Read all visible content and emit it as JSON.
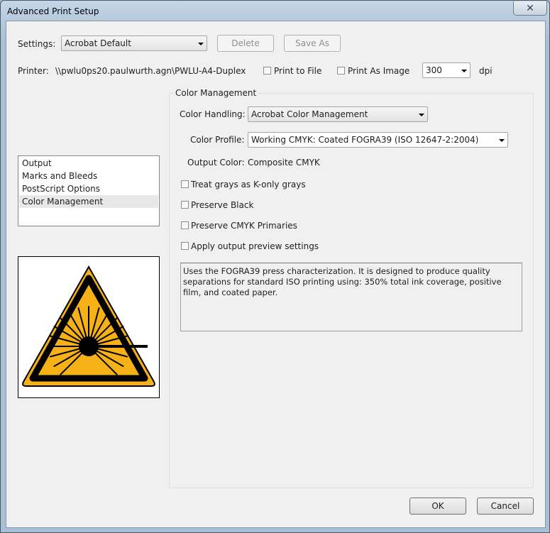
{
  "window": {
    "title": "Advanced Print Setup",
    "close_glyph": "✕"
  },
  "settings": {
    "label": "Settings:",
    "value": "Acrobat Default",
    "delete_label": "Delete",
    "save_as_label": "Save As"
  },
  "printer": {
    "label": "Printer:",
    "name": "\\\\pwlu0ps20.paulwurth.agn\\PWLU-A4-Duplex",
    "print_to_file_label": "Print to File",
    "print_as_image_label": "Print As Image",
    "dpi_value": "300",
    "dpi_label": "dpi"
  },
  "sidebar": {
    "items": [
      {
        "label": "Output"
      },
      {
        "label": "Marks and Bleeds"
      },
      {
        "label": "PostScript Options"
      },
      {
        "label": "Color Management"
      }
    ],
    "selected": "Color Management",
    "preview_icon": "laser-warning-icon",
    "preview_colors": {
      "fill": "#f6b117",
      "outline": "#000000"
    }
  },
  "color_management": {
    "heading": "Color Management",
    "handling_label": "Color Handling:",
    "handling_value": "Acrobat Color Management",
    "profile_label": "Color Profile:",
    "profile_value": "Working CMYK: Coated FOGRA39 (ISO 12647-2:2004)",
    "output_color_label": "Output Color:",
    "output_color_value": "Composite CMYK",
    "checkboxes": [
      {
        "label": "Treat grays as K-only grays",
        "checked": false
      },
      {
        "label": "Preserve Black",
        "checked": false
      },
      {
        "label": "Preserve CMYK Primaries",
        "checked": false
      },
      {
        "label": "Apply output preview settings",
        "checked": false
      }
    ],
    "description": "Uses the FOGRA39 press characterization. It is designed to produce quality separations for standard ISO printing using: 350% total ink coverage, positive film, and coated paper."
  },
  "footer": {
    "ok_label": "OK",
    "cancel_label": "Cancel"
  }
}
